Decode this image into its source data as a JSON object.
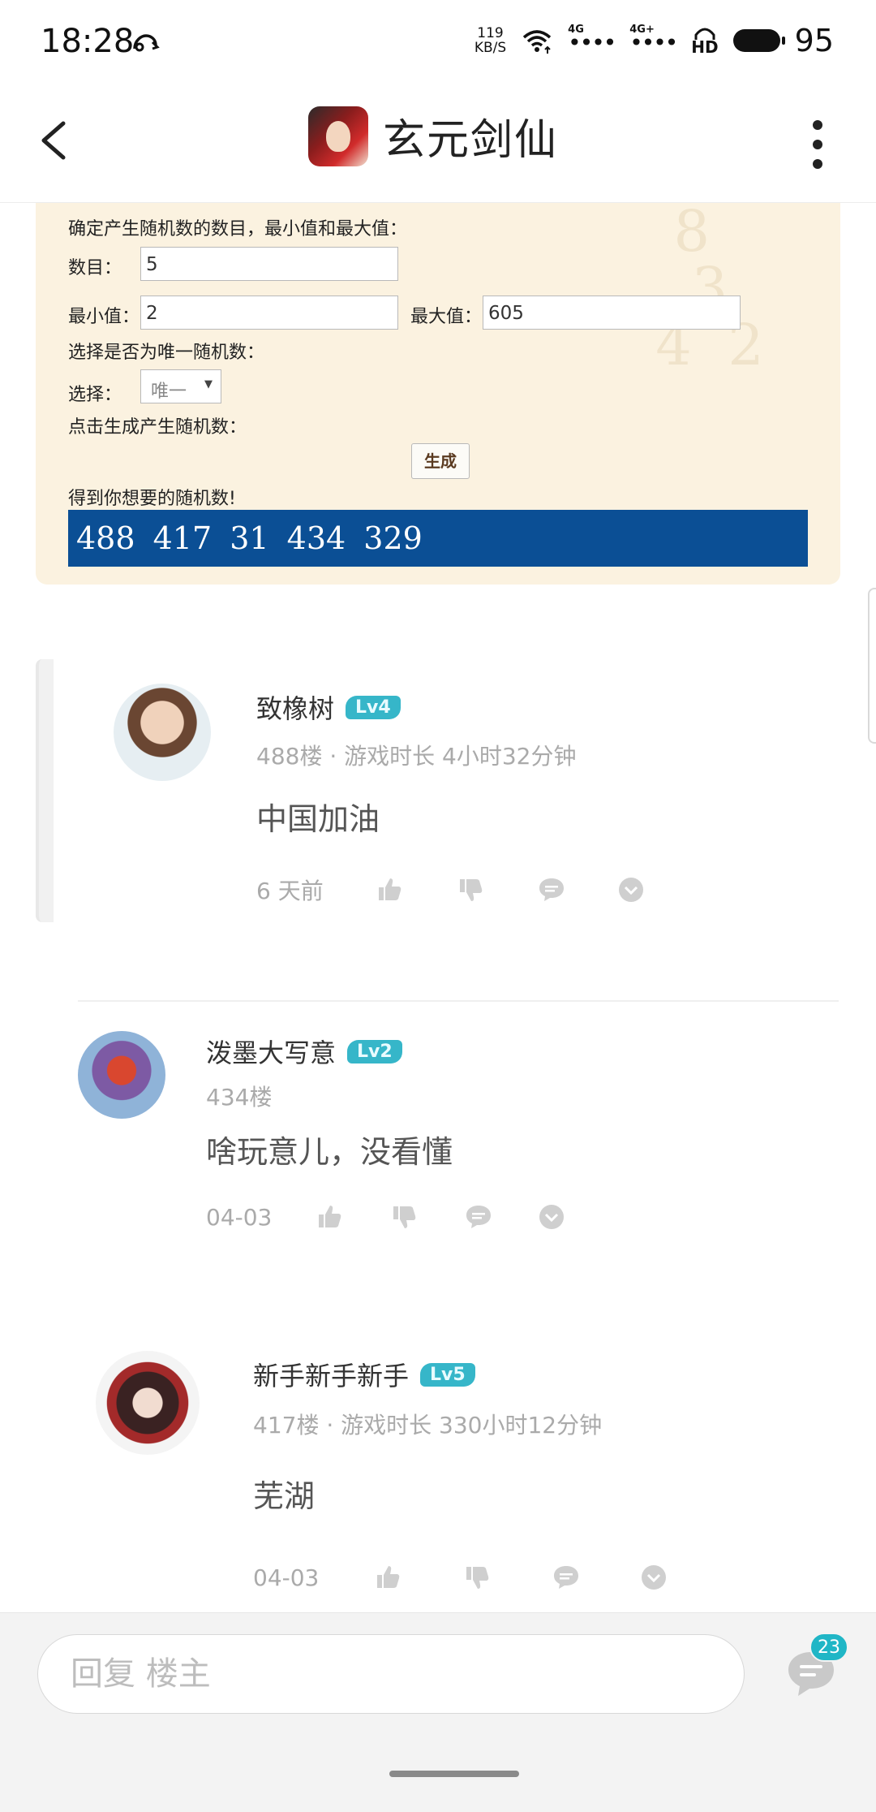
{
  "status_bar": {
    "time": "18:28",
    "net_speed_value": "119",
    "net_speed_unit": "KB/S",
    "signal1_label": "4G",
    "signal2_label": "4G+",
    "hd_label": "HD",
    "battery_pct": "95"
  },
  "header": {
    "title": "玄元剑仙"
  },
  "generator": {
    "intro": "确定产生随机数的数目，最小值和最大值：",
    "count_label": "数目：",
    "count_value": "5",
    "min_label": "最小值：",
    "min_value": "2",
    "max_label": "最大值：",
    "max_value": "605",
    "unique_prompt": "选择是否为唯一随机数：",
    "select_label": "选择：",
    "select_value": "唯一",
    "generate_prompt": "点击生成产生随机数：",
    "generate_button": "生成",
    "result_label": "得到你想要的随机数!",
    "result": "488 417 31 434 329"
  },
  "comments": [
    {
      "name": "致橡树",
      "level": "Lv4",
      "meta": "488楼 · 游戏时长 4小时32分钟",
      "text": "中国加油",
      "time": "6 天前"
    },
    {
      "name": "泼墨大写意",
      "level": "Lv2",
      "meta": "434楼",
      "text": "啥玩意儿，没看懂",
      "time": "04-03"
    },
    {
      "name": "新手新手新手",
      "level": "Lv5",
      "meta": "417楼 · 游戏时长 330小时12分钟",
      "text": "芜湖",
      "time": "04-03"
    }
  ],
  "bottom": {
    "reply_placeholder": "回复  楼主",
    "comment_count": "23"
  },
  "colors": {
    "accent": "#36b6c9",
    "result_bg": "#0b4f95",
    "panel_bg": "#fbf2e0"
  }
}
